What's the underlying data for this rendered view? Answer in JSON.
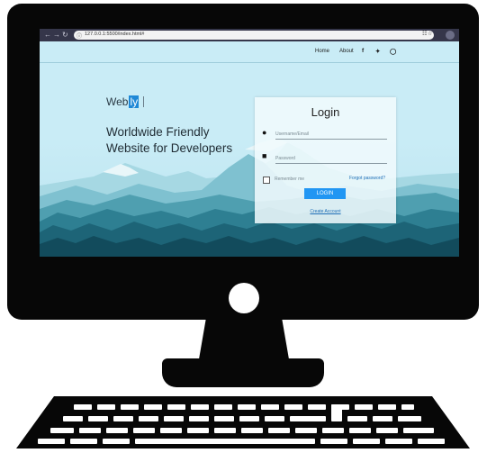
{
  "browser": {
    "url": "127.0.0.1:5500/index.html#",
    "nav_icons": [
      "back-arrow-icon",
      "forward-arrow-icon",
      "reload-icon"
    ],
    "right_icons": [
      "translate-icon",
      "bookmark-star-icon",
      "profile-icon"
    ]
  },
  "navbar": {
    "links": [
      "Home",
      "About"
    ],
    "social_icons": [
      "facebook-icon",
      "twitter-icon",
      "instagram-icon"
    ]
  },
  "brand": {
    "prefix": "Web",
    "highlight": "ly"
  },
  "hero": {
    "line1": "Worldwide Friendly",
    "line2": "Website for Developers"
  },
  "login": {
    "title": "Login",
    "username_placeholder": "Username/Email",
    "password_placeholder": "Password",
    "remember_label": "Remember me",
    "forgot_label": "Forgot password?",
    "button_label": "LOGIN",
    "create_label": "Create Account"
  },
  "colors": {
    "accent": "#2196f3",
    "sky": "#c9ecf6",
    "mountains": [
      "#7fc1d0",
      "#4f9fb0",
      "#2e7f92",
      "#1d6477",
      "#124b5c"
    ],
    "browser_bar": "#35364a"
  }
}
